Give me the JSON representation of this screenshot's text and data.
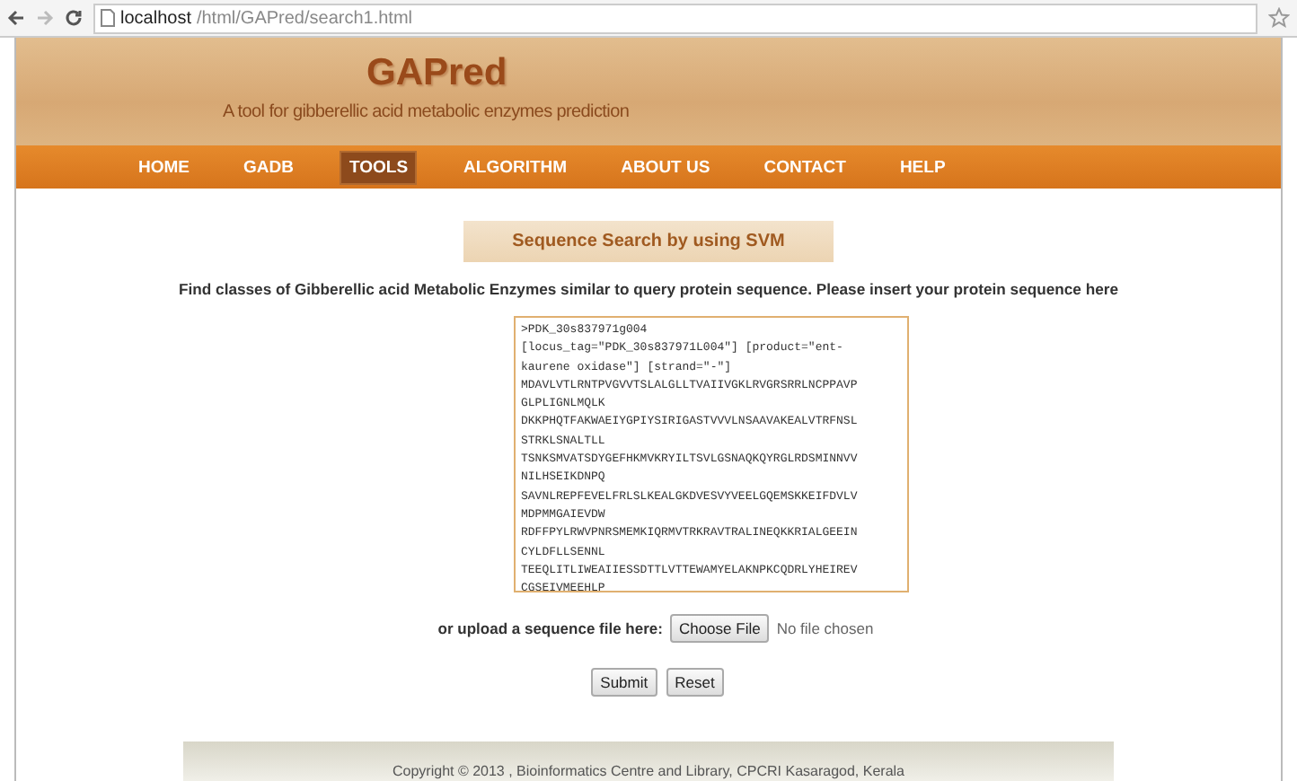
{
  "browser": {
    "url_host": "localhost",
    "url_path": "/html/GAPred/search1.html"
  },
  "header": {
    "title": "GAPred",
    "subtitle": "A tool for gibberellic acid metabolic enzymes prediction"
  },
  "nav": [
    {
      "label": "HOME",
      "selected": false
    },
    {
      "label": "GADB",
      "selected": false
    },
    {
      "label": "TOOLS",
      "selected": true
    },
    {
      "label": "ALGORITHM",
      "selected": false
    },
    {
      "label": "ABOUT US",
      "selected": false
    },
    {
      "label": "CONTACT",
      "selected": false
    },
    {
      "label": "HELP",
      "selected": false
    }
  ],
  "section_title": "Sequence Search by using SVM",
  "instruction": "Find classes of Gibberellic acid Metabolic Enzymes similar to query protein sequence. Please insert your protein sequence here",
  "sequence_lines": [
    ">PDK_30s837971g004",
    "[locus_tag=\"PDK_30s837971L004\"] [product=\"ent-",
    "kaurene oxidase\"] [strand=\"-\"]",
    "MDAVLVTLRNTPVGVVTSLALGLLTVAIIVGKLRVGRSRRLNCPPAVP",
    "GLPLIGNLMQLK",
    "DKKPHQTFAKWAEIYGPIYSIRIGASTVVVLNSAAVAKEALVTRFNSL",
    "STRKLSNALTLL",
    "TSNKSMVATSDYGEFHKMVKRYILTSVLGSNAQKQYRGLRDSMINNVV",
    "NILHSEIKDNPQ",
    "SAVNLREPFEVELFRLSLKEALGKDVESVYVEELGQEMSKKEIFDVLV",
    "MDPMMGAIEVDW",
    "RDFFPYLRWVPNRSMEMKIQRMVTRKRAVTRALINEQKKRIALGEEIN",
    "CYLDFLLSENNL",
    "TEEQLITLIWEAIIESSDTTLVTTEWAMYELAKNPKCQDRLYHEIREV",
    "CGSEIVMEEHLP"
  ],
  "upload": {
    "label": "or upload a sequence file here:",
    "button": "Choose File",
    "status": "No file chosen"
  },
  "buttons": [
    "Submit",
    "Reset"
  ],
  "footer": "Copyright © 2013 , Bioinformatics Centre and Library, CPCRI Kasaragod, Kerala"
}
